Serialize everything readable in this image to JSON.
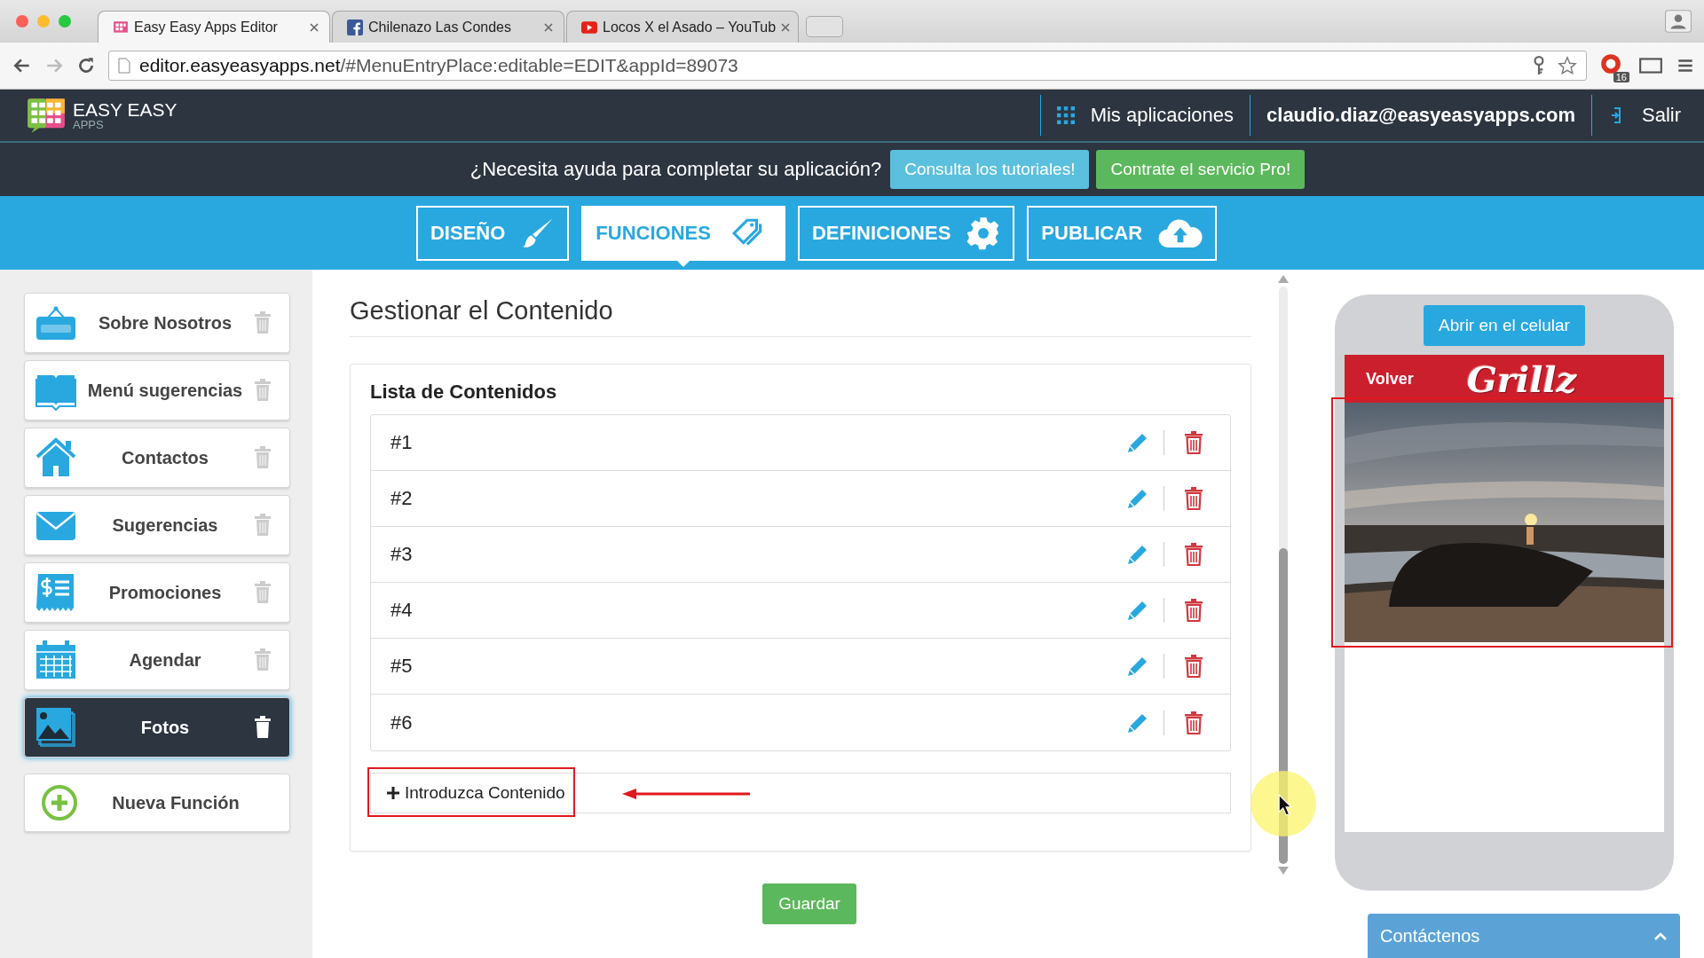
{
  "browser": {
    "tabs": [
      {
        "title": "Easy Easy Apps Editor",
        "kind": "grid",
        "selected": true
      },
      {
        "title": "Chilenazo Las Condes",
        "kind": "facebook",
        "selected": false
      },
      {
        "title": "Locos X el Asado – YouTub",
        "kind": "youtube",
        "selected": false
      }
    ],
    "url_host": "editor.easyeasyapps.net",
    "url_rest": "/#MenuEntryPlace:editable=EDIT&appId=89073",
    "extension_badge": "16"
  },
  "header": {
    "logo_title": "EASY EASY",
    "logo_sub": "APPS",
    "apps_link": "Mis aplicaciones",
    "user": "claudio.diaz@easyeasyapps.com",
    "logout": "Salir"
  },
  "help_bar": {
    "text": "¿Necesita ayuda para completar su aplicación?",
    "buttons": [
      {
        "label": "Consulta los tutoriales!",
        "kind": "info"
      },
      {
        "label": "Contrate el servicio Pro!",
        "kind": "success"
      }
    ]
  },
  "main_tabs": [
    {
      "label": "DISEÑO",
      "kind": "brush",
      "selected": false
    },
    {
      "label": "FUNCIONES",
      "kind": "tags",
      "selected": true
    },
    {
      "label": "DEFINICIONES",
      "kind": "gear",
      "selected": false
    },
    {
      "label": "PUBLICAR",
      "kind": "cloud",
      "selected": false
    }
  ],
  "sidebar": {
    "items": [
      {
        "label": "Sobre Nosotros",
        "kind": "open",
        "selected": false
      },
      {
        "label": "Menú sugerencias",
        "kind": "book",
        "selected": false
      },
      {
        "label": "Contactos",
        "kind": "house",
        "selected": false
      },
      {
        "label": "Sugerencias",
        "kind": "mail",
        "selected": false
      },
      {
        "label": "Promociones",
        "kind": "receipt",
        "selected": false
      },
      {
        "label": "Agendar",
        "kind": "calendar",
        "selected": false
      },
      {
        "label": "Fotos",
        "kind": "photos",
        "selected": true
      }
    ],
    "add_button": "Nueva Función"
  },
  "content": {
    "title": "Gestionar el Contenido",
    "list_title": "Lista de Contenidos",
    "items": [
      "#1",
      "#2",
      "#3",
      "#4",
      "#5",
      "#6"
    ],
    "add_label": "Introduzca Contenido",
    "save_button": "Guardar"
  },
  "preview": {
    "open_button": "Abrir en el celular",
    "back": "Volver",
    "brand": "Grillz",
    "contact_bar": "Contáctenos"
  }
}
